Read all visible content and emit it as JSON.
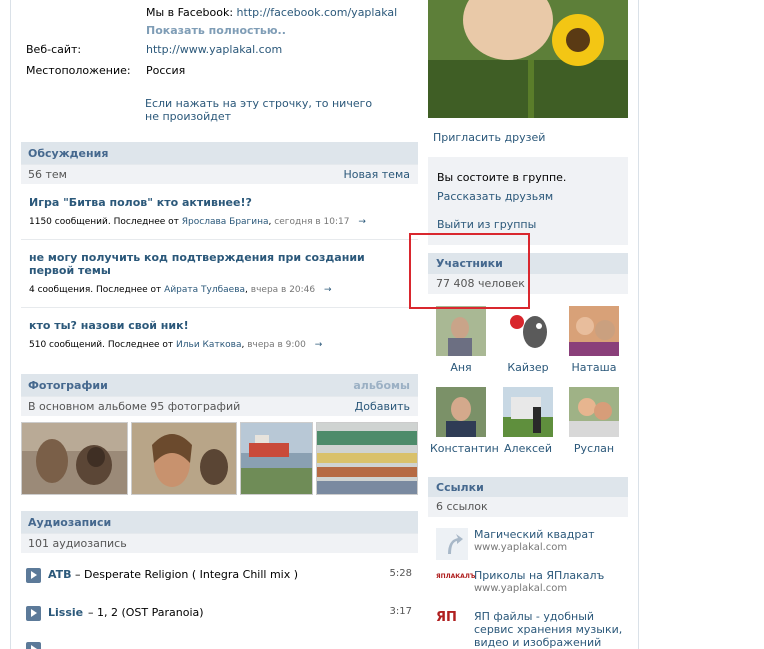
{
  "profile_info": {
    "facebook_prefix": "Мы в Facebook:",
    "facebook_url": "http://facebook.com/yaplakal",
    "show_more": "Показать полностью..",
    "website_label": "Веб-сайт:",
    "website_value": "http://www.yaplakal.com",
    "location_label": "Местоположение:",
    "location_value": "Россия",
    "notice": "Если нажать на эту строчку, то ничего не произойдет"
  },
  "discussions": {
    "title": "Обсуждения",
    "count": "56 тем",
    "new_topic": "Новая тема",
    "topics": [
      {
        "title": "Игра \"Битва полов\" кто активнее!?",
        "meta_prefix": "1150 сообщений. Последнее от",
        "author": "Ярослава Брагина",
        "time": "сегодня в 10:17"
      },
      {
        "title": "не могу получить код подтверждения при создании первой темы",
        "meta_prefix": "4 сообщения. Последнее от",
        "author": "Айрата Тулбаева",
        "time": "вчера в 20:46"
      },
      {
        "title": "кто ты? назови свой ник!",
        "meta_prefix": "510 сообщений. Последнее от",
        "author": "Ильи Каткова",
        "time": "вчера в 9:00"
      }
    ],
    "arrow": "→"
  },
  "photos": {
    "title": "Фотографии",
    "albums_link": "альбомы",
    "count": "В основном альбоме 95 фотографий",
    "add": "Добавить"
  },
  "audio": {
    "title": "Аудиозаписи",
    "count": "101 аудиозапись",
    "tracks": [
      {
        "artist": "ATB",
        "title": "– Desperate Religion ( Integra Chill mix )",
        "duration": "5:28"
      },
      {
        "artist": "Lissie",
        "title": "– 1, 2 (OST Paranoia)",
        "duration": "3:17"
      }
    ]
  },
  "sidebar": {
    "invite_friends": "Пригласить друзей",
    "member_status": "Вы состоите в группе.",
    "tell_friends": "Рассказать друзьям",
    "leave_group": "Выйти из группы",
    "members_title": "Участники",
    "members_count": "77 408 человек",
    "members": [
      {
        "name": "Аня",
        "color": "#8fa07a"
      },
      {
        "name": "Кайзер",
        "color": "#ffffff"
      },
      {
        "name": "Наташа",
        "color": "#c77a55"
      },
      {
        "name": "Константин",
        "color": "#6f8a5e"
      },
      {
        "name": "Алексей",
        "color": "#7c9a6a"
      },
      {
        "name": "Руслан",
        "color": "#a78b6d"
      }
    ],
    "links_title": "Ссылки",
    "links_count": "6 ссылок",
    "links": [
      {
        "title": "Магический квадрат",
        "url": "www.yaplakal.com"
      },
      {
        "title": "Приколы на ЯПлакалъ",
        "url": "www.yaplakal.com"
      },
      {
        "title": "ЯП файлы - удобный сервис хранения музыки, видео и изображений",
        "url": ""
      }
    ],
    "link_logo_text": "ЯПЛАКАЛЪ",
    "link_logo_text2": "ЯП"
  },
  "colors": {
    "link": "#2b587a",
    "header_bg": "#dee5eb",
    "sub_bg": "#f0f2f5",
    "highlight": "#d9272e"
  }
}
